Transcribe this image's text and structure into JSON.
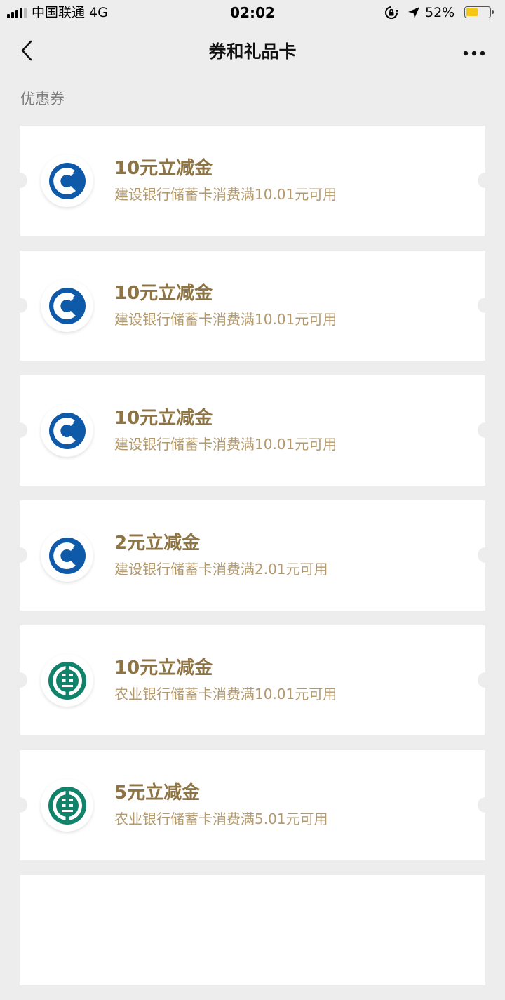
{
  "status_bar": {
    "carrier": "中国联通   4G",
    "time": "02:02",
    "battery_percent": "52%",
    "battery_level": 0.52,
    "battery_color": "#f5c518",
    "icons": [
      "signal-icon",
      "orientation-lock-icon",
      "location-arrow-icon",
      "battery-icon"
    ]
  },
  "nav": {
    "title": "券和礼品卡",
    "back_icon": "chevron-left-icon",
    "more_icon": "more-dots-icon"
  },
  "section": {
    "title": "优惠券"
  },
  "colors": {
    "background": "#ededed",
    "card": "#ffffff",
    "title_gold": "#8f7443",
    "desc_gold": "#b39a6e",
    "ccb_blue": "#0f5aa8",
    "abc_green": "#12836b"
  },
  "coupons": [
    {
      "bank": "ccb",
      "logo_icon": "ccb-bank-logo-icon",
      "title": "10元立减金",
      "desc": "建设银行储蓄卡消费满10.01元可用"
    },
    {
      "bank": "ccb",
      "logo_icon": "ccb-bank-logo-icon",
      "title": "10元立减金",
      "desc": "建设银行储蓄卡消费满10.01元可用"
    },
    {
      "bank": "ccb",
      "logo_icon": "ccb-bank-logo-icon",
      "title": "10元立减金",
      "desc": "建设银行储蓄卡消费满10.01元可用"
    },
    {
      "bank": "ccb",
      "logo_icon": "ccb-bank-logo-icon",
      "title": "2元立减金",
      "desc": "建设银行储蓄卡消费满2.01元可用"
    },
    {
      "bank": "abc",
      "logo_icon": "abc-bank-logo-icon",
      "title": "10元立减金",
      "desc": "农业银行储蓄卡消费满10.01元可用"
    },
    {
      "bank": "abc",
      "logo_icon": "abc-bank-logo-icon",
      "title": "5元立减金",
      "desc": "农业银行储蓄卡消费满5.01元可用"
    },
    {
      "bank": "",
      "logo_icon": "",
      "title": "",
      "desc": ""
    }
  ]
}
